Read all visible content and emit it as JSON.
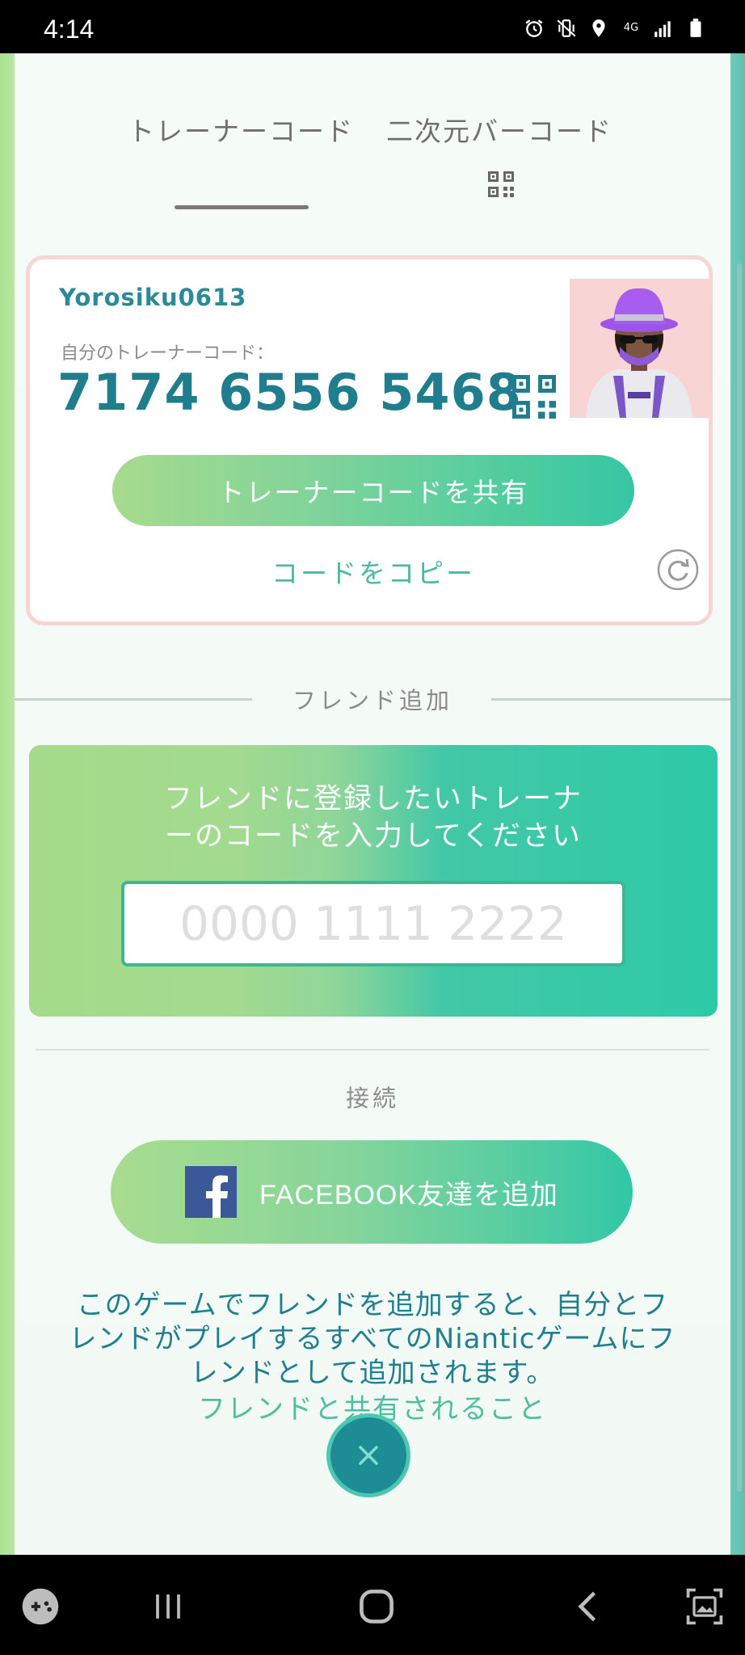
{
  "status_bar": {
    "time": "4:14",
    "network": "4G"
  },
  "tabs": [
    {
      "label": "トレーナーコード",
      "active": true
    },
    {
      "label": "二次元バーコード",
      "active": false
    }
  ],
  "card": {
    "username": "Yorosiku0613",
    "code_label": "自分のトレーナーコード：",
    "code": "7174 6556 5468",
    "share_label": "トレーナーコードを共有",
    "copy_label": "コードをコピー"
  },
  "add_friend": {
    "section_title": "フレンド追加",
    "prompt_line1": "フレンドに登録したいトレーナ",
    "prompt_line2": "ーのコードを入力してください",
    "input_placeholder": "0000 1111 2222",
    "input_value": ""
  },
  "connect": {
    "section_title": "接続",
    "facebook_label": "FACEBOOK友達を追加"
  },
  "info": {
    "line1": "このゲームでフレンドを追加すると、自分とフ",
    "line2": "レンドがプレイするすべてのNianticゲームにフ",
    "line3": "レンドとして追加されます。",
    "link": "フレンドと共有されること"
  },
  "colors": {
    "accent_teal": "#1f7d8d",
    "accent_green": "#48b9a2",
    "facebook_blue": "#3b5998"
  },
  "icons": [
    "alarm-icon",
    "vibrate-icon",
    "location-icon",
    "signal-icon",
    "battery-icon",
    "qr-code-icon",
    "refresh-icon",
    "facebook-icon",
    "close-icon",
    "game-launcher-icon",
    "recent-apps-icon",
    "home-icon",
    "back-icon",
    "screenshot-icon"
  ]
}
